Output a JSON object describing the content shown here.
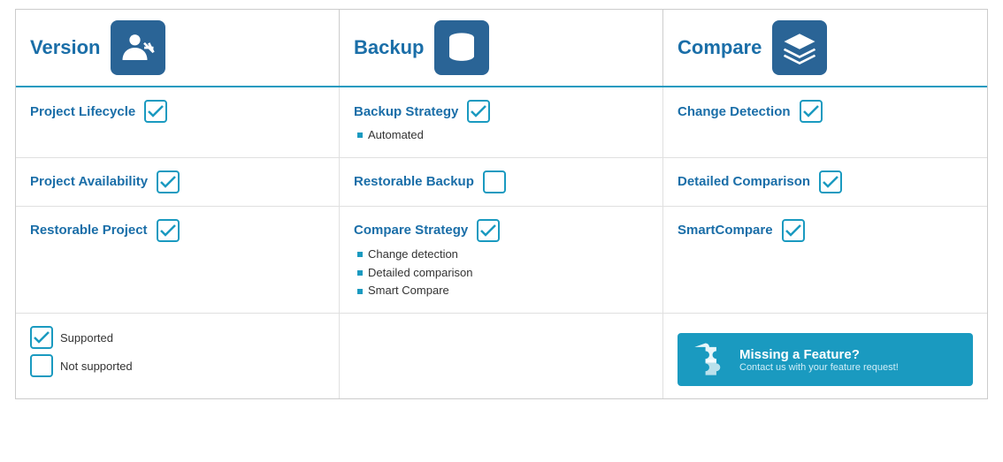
{
  "header": {
    "col1": {
      "title": "Version",
      "icon": "person-icon"
    },
    "col2": {
      "title": "Backup",
      "icon": "database-icon"
    },
    "col3": {
      "title": "Compare",
      "icon": "layers-icon"
    }
  },
  "rows": [
    {
      "col1": {
        "label": "Project Lifecycle",
        "checked": true
      },
      "col2": {
        "label": "Backup Strategy",
        "checked": true,
        "sub": [
          "Automated"
        ]
      },
      "col3": {
        "label": "Change Detection",
        "checked": true
      }
    },
    {
      "col1": {
        "label": "Project Availability",
        "checked": true
      },
      "col2": {
        "label": "Restorable Backup",
        "checked": false
      },
      "col3": {
        "label": "Detailed Comparison",
        "checked": true
      }
    },
    {
      "col1": {
        "label": "Restorable Project",
        "checked": true
      },
      "col2": {
        "label": "Compare Strategy",
        "checked": true,
        "sub": [
          "Change detection",
          "Detailed comparison",
          "Smart Compare"
        ]
      },
      "col3": {
        "label": "SmartCompare",
        "checked": true
      }
    }
  ],
  "legend": {
    "supported": "Supported",
    "not_supported": "Not supported"
  },
  "missing": {
    "title": "Missing a Feature?",
    "subtitle": "Contact us with your feature request!"
  }
}
